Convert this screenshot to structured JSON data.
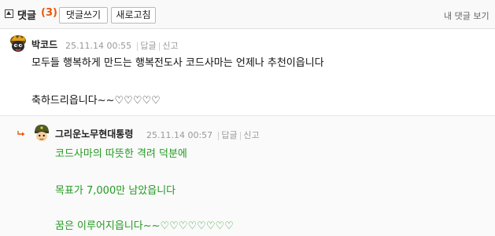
{
  "toolbar": {
    "title": "댓글",
    "count": "(3)",
    "write_label": "댓글쓰기",
    "refresh_label": "새로고침",
    "my_comments_label": "내 댓글 보기"
  },
  "comments": [
    {
      "author": "박코드",
      "timestamp": "25.11.14 00:55",
      "reply_label": "답글",
      "report_label": "신고",
      "avatar_icon": "mushroom-character-avatar-icon",
      "text_color": "#111111",
      "lines": [
        "모두들 행복하게 만드는 행복전도사 코드사마는 언제나 추천이읍니다",
        "축하드리읍니다~~♡♡♡♡♡"
      ]
    },
    {
      "author": "그리운노무현대통령",
      "timestamp": "25.11.14 00:57",
      "reply_label": "답글",
      "report_label": "신고",
      "avatar_icon": "helmet-character-avatar-icon",
      "is_reply": true,
      "text_color": "#229a1f",
      "lines": [
        "코드사마의 따뜻한 격려 덕분에",
        "목표가 7,000만 남았읍니다",
        "꿈은 이루어지읍니다~~♡♡♡♡♡♡♡♡"
      ]
    }
  ]
}
